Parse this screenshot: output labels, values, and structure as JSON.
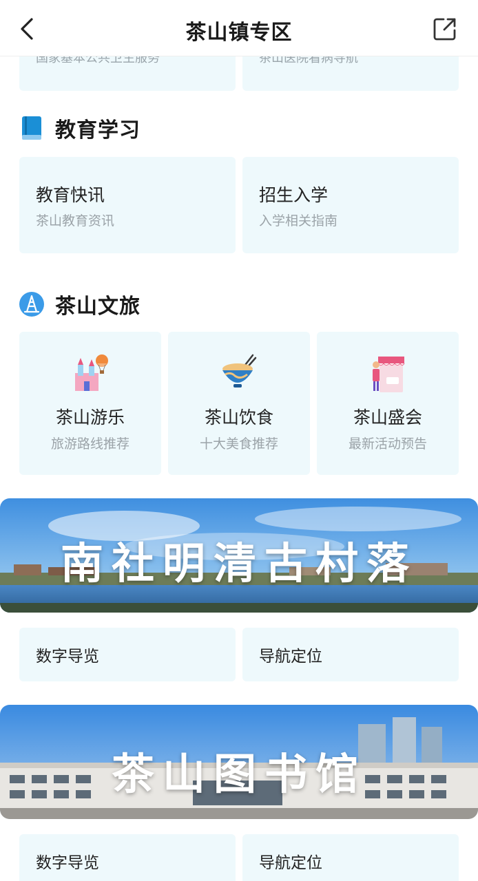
{
  "header": {
    "title": "茶山镇专区",
    "back_icon": "chevron-left-icon",
    "share_icon": "share-icon"
  },
  "partial_cards": [
    {
      "text": "国家基本公共卫生服务"
    },
    {
      "text": "茶山医院看病导航"
    }
  ],
  "education": {
    "title": "教育学习",
    "icon": "book-icon",
    "accent": "#1b8fd6",
    "cards": [
      {
        "title": "教育快讯",
        "subtitle": "茶山教育资讯"
      },
      {
        "title": "招生入学",
        "subtitle": "入学相关指南"
      }
    ]
  },
  "tourism": {
    "title": "茶山文旅",
    "icon": "tower-icon",
    "accent": "#3b9be8",
    "cards": [
      {
        "title": "茶山游乐",
        "subtitle": "旅游路线推荐",
        "icon": "castle-balloon-icon"
      },
      {
        "title": "茶山饮食",
        "subtitle": "十大美食推荐",
        "icon": "food-bowl-icon"
      },
      {
        "title": "茶山盛会",
        "subtitle": "最新活动预告",
        "icon": "event-booth-icon"
      }
    ]
  },
  "banner1": {
    "text": "南社明清古村落",
    "links": [
      {
        "label": "数字导览"
      },
      {
        "label": "导航定位"
      }
    ]
  },
  "banner2": {
    "text": "茶山图书馆",
    "links": [
      {
        "label": "数字导览"
      },
      {
        "label": "导航定位"
      }
    ]
  },
  "colors": {
    "card_bg": "#eef9fc",
    "title_text": "#222222",
    "subtitle_text": "#9ba3a8"
  }
}
